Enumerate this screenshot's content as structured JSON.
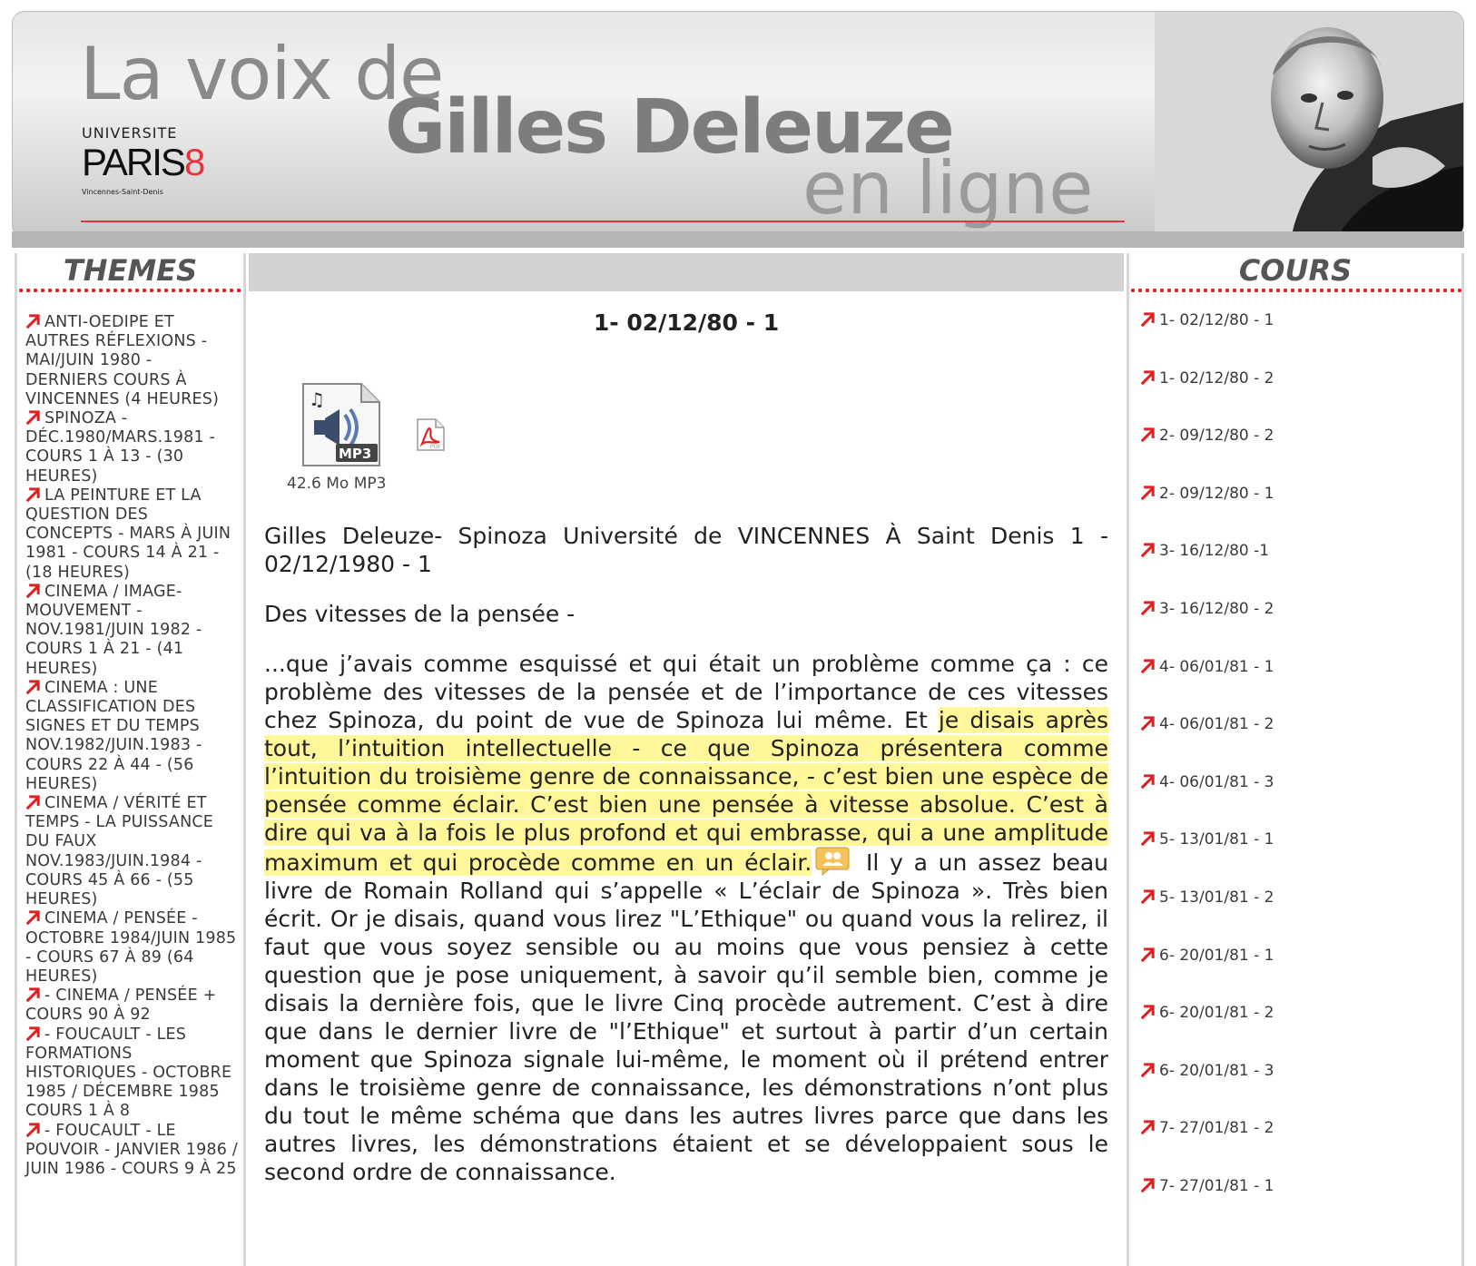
{
  "banner": {
    "line1": "La voix de",
    "line2": "Gilles Deleuze",
    "line3": "en ligne",
    "logo_universite": "UNIVERSITE",
    "logo_paris": "PARIS",
    "logo_8": "8",
    "logo_sub": "Vincennes-Saint-Denis"
  },
  "themes": {
    "title": "THEMES",
    "items": [
      "ANTI-OEDIPE ET AUTRES RÉFLEXIONS - MAI/JUIN 1980 - DERNIERS COURS À VINCENNES (4 HEURES)",
      "SPINOZA - DÉC.1980/MARS.1981 - COURS 1 À 13 - (30 HEURES)",
      "LA PEINTURE ET LA QUESTION DES CONCEPTS - MARS À JUIN 1981 - COURS 14 À 21 - (18 HEURES)",
      "CINEMA / IMAGE-MOUVEMENT - NOV.1981/JUIN 1982 - COURS 1 À 21 - (41 HEURES)",
      "CINEMA : UNE CLASSIFICATION DES SIGNES ET DU TEMPS NOV.1982/JUIN.1983 - COURS 22 À 44 - (56 HEURES)",
      "CINEMA / VÉRITÉ ET TEMPS - LA PUISSANCE DU FAUX NOV.1983/JUIN.1984 - COURS 45 À 66 - (55 HEURES)",
      "CINEMA / PENSÉE - OCTOBRE 1984/JUIN 1985 - COURS 67 À 89 (64 HEURES)",
      "- CINEMA / PENSÉE + COURS 90 À 92",
      "- FOUCAULT - LES FORMATIONS HISTORIQUES - OCTOBRE 1985 / DÉCEMBRE 1985 COURS 1 À 8",
      "- FOUCAULT - LE POUVOIR - JANVIER 1986 / JUIN 1986 - COURS 9 À 25"
    ]
  },
  "cours": {
    "title": "COURS",
    "items": [
      "1- 02/12/80 - 1",
      "1- 02/12/80 - 2",
      "2- 09/12/80 - 2",
      "2- 09/12/80 - 1",
      "3- 16/12/80 -1",
      "3- 16/12/80 - 2",
      "4- 06/01/81 - 1",
      "4- 06/01/81 - 2",
      "4- 06/01/81 - 3",
      "5- 13/01/81 - 1",
      "5- 13/01/81 - 2",
      "6- 20/01/81 - 1",
      "6- 20/01/81 - 2",
      "6- 20/01/81 - 3",
      "7- 27/01/81 - 2",
      "7- 27/01/81 - 1"
    ]
  },
  "main": {
    "title": "1- 02/12/80 - 1",
    "mp3_label": "MP3",
    "mp3_caption": "42.6 Mo MP3",
    "pdf_label": "PDF",
    "heading": "Gilles Deleuze- Spinoza Université de VINCENNES À Saint Denis 1 - 02/12/1980 - 1",
    "subheading": "Des vitesses de la pensée -",
    "para_before": "...que j’avais comme esquissé et qui était un problème comme ça : ce problème des vitesses de la pensée et de l’importance de ces vitesses chez Spinoza, du point de vue de Spinoza lui même. Et ",
    "para_highlight": "je disais après tout, l’intuition intellectuelle - ce que Spinoza présentera comme l’intuition du troisième genre de connaissance, - c’est bien une espèce de pensée comme éclair. C’est bien une pensée à vitesse absolue. C’est à dire qui va à la fois le plus profond et qui embrasse, qui a une amplitude maximum et qui procède comme en un éclair.",
    "para_after": " Il y a un assez beau livre de Romain Rolland qui s’appelle « L’éclair de Spinoza ». Très bien écrit. Or je disais, quand vous lirez \"L’Ethique\" ou quand vous la relirez, il faut que vous soyez sensible ou au moins que vous pensiez à cette question que je pose uniquement, à savoir qu’il semble bien, comme je disais la dernière fois, que le livre Cinq procède autrement. C’est à dire que dans le dernier livre de \"l’Ethique\" et surtout à partir d’un certain moment que Spinoza signale lui-même, le moment où il prétend entrer dans le troisième genre de connaissance, les démonstrations n’ont plus du tout le même schéma que dans les autres livres parce que dans les autres livres, les démonstrations étaient et se développaient sous le second ordre de connaissance."
  },
  "colors": {
    "accent_red": "#e4343c",
    "highlight": "#fff79a",
    "sidebar_border": "#d6d6d6",
    "gray_bar": "#b5b5b5"
  },
  "icons": [
    "arrow-icon",
    "mp3-icon",
    "pdf-icon",
    "annotation-icon",
    "portrait-photo"
  ]
}
